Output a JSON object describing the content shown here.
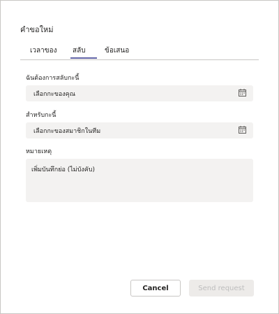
{
  "dialog": {
    "title": "คำขอใหม่",
    "tabs": [
      {
        "label": "เวลาของ",
        "selected": false
      },
      {
        "label": "สลับ",
        "selected": true
      },
      {
        "label": "ข้อเสนอ",
        "selected": false
      }
    ],
    "accent_color": "#6264a7",
    "swap_from": {
      "label": "ฉันต้องการสลับกะนี้",
      "placeholder": "เลือกกะของคุณ",
      "icon": "calendar-icon"
    },
    "swap_for": {
      "label": "สำหรับกะนี้",
      "placeholder": "เลือกกะของสมาชิกในทีม",
      "icon": "calendar-icon"
    },
    "note": {
      "label": "หมายเหตุ",
      "placeholder": "เพิ่มบันทึกย่อ (ไม่บังคับ)"
    },
    "buttons": {
      "cancel": "Cancel",
      "send": "Send request",
      "send_enabled": false
    }
  }
}
